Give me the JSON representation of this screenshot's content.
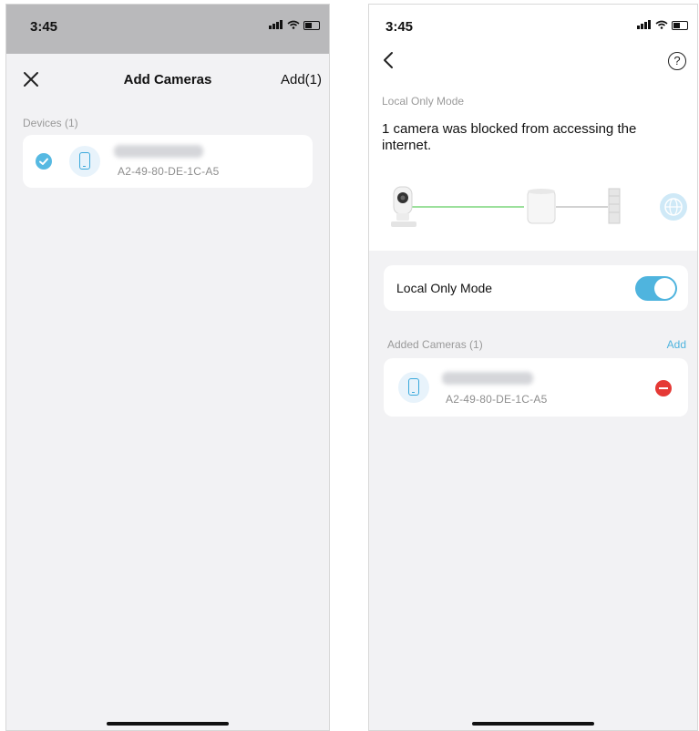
{
  "left": {
    "status_time": "3:45",
    "title": "Add Cameras",
    "add_button": "Add(1)",
    "section": "Devices (1)",
    "device_mac": "A2-49-80-DE-1C-A5"
  },
  "right": {
    "status_time": "3:45",
    "page_label": "Local Only Mode",
    "headline": "1 camera was blocked from accessing the internet.",
    "toggle_label": "Local Only Mode",
    "toggle_on": true,
    "section": "Added Cameras (1)",
    "add_link": "Add",
    "device_mac": "A2-49-80-DE-1C-A5"
  },
  "colors": {
    "accent": "#4fb4de",
    "remove": "#e53935",
    "background": "#f2f2f4",
    "status_dim": "#b9b9bb"
  },
  "icons": [
    "close-icon",
    "check-icon",
    "phone-icon",
    "back-icon",
    "help-icon",
    "camera-icon",
    "router-icon",
    "firewall-icon",
    "globe-icon",
    "remove-icon",
    "signal-icon",
    "wifi-icon",
    "battery-icon"
  ]
}
